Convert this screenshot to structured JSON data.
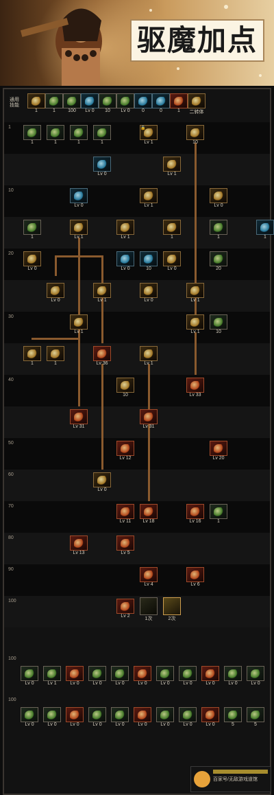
{
  "banner": {
    "title": "驱魔加点"
  },
  "header": {
    "general_skills_label": "通用\n技能",
    "lv_label": "Lv.",
    "items": [
      "1",
      "1",
      "100",
      "Lv 0",
      "10",
      "Lv 0",
      "0",
      "0",
      "1",
      "二转体"
    ]
  },
  "row_labels": [
    "1",
    "10",
    "20",
    "30",
    "40",
    "50",
    "60",
    "70",
    "80",
    "90",
    "100",
    "100",
    "100"
  ],
  "skills": [
    {
      "r": 0,
      "c": 0,
      "t": "1",
      "k": "g"
    },
    {
      "r": 0,
      "c": 1,
      "t": "1",
      "k": "g"
    },
    {
      "r": 0,
      "c": 2,
      "t": "1",
      "k": "g"
    },
    {
      "r": 0,
      "c": 3,
      "t": "1",
      "k": "g"
    },
    {
      "r": 0,
      "c": 5,
      "t": "Lv 1",
      "k": "gold",
      "lock": true
    },
    {
      "r": 0,
      "c": 7,
      "t": "10",
      "k": "gold"
    },
    {
      "r": 1,
      "c": 3,
      "t": "Lv 0",
      "k": "blue"
    },
    {
      "r": 1,
      "c": 6,
      "t": "Lv 1",
      "k": "gold"
    },
    {
      "r": 2,
      "c": 2,
      "t": "Lv 0",
      "k": "blue"
    },
    {
      "r": 2,
      "c": 5,
      "t": "Lv 1",
      "k": "gold"
    },
    {
      "r": 2,
      "c": 8,
      "t": "Lv 0",
      "k": "gold"
    },
    {
      "r": 3,
      "c": 0,
      "t": "1",
      "k": "g"
    },
    {
      "r": 3,
      "c": 2,
      "t": "Lv 1",
      "k": "gold"
    },
    {
      "r": 3,
      "c": 4,
      "t": "Lv 1",
      "k": "gold"
    },
    {
      "r": 3,
      "c": 6,
      "t": "1",
      "k": "gold"
    },
    {
      "r": 3,
      "c": 8,
      "t": "1",
      "k": "g"
    },
    {
      "r": 3,
      "c": 10,
      "t": "1",
      "k": "blue"
    },
    {
      "r": 4,
      "c": 0,
      "t": "Lv 0",
      "k": "gold"
    },
    {
      "r": 4,
      "c": 4,
      "t": "Lv 0",
      "k": "blue"
    },
    {
      "r": 4,
      "c": 5,
      "t": "10",
      "k": "blue"
    },
    {
      "r": 4,
      "c": 6,
      "t": "Lv 0",
      "k": "gold"
    },
    {
      "r": 4,
      "c": 8,
      "t": "20",
      "k": "g"
    },
    {
      "r": 5,
      "c": 1,
      "t": "Lv 0",
      "k": "gold"
    },
    {
      "r": 5,
      "c": 3,
      "t": "Lv 1",
      "k": "gold"
    },
    {
      "r": 5,
      "c": 5,
      "t": "Lv 0",
      "k": "gold"
    },
    {
      "r": 5,
      "c": 7,
      "t": "Lv 1",
      "k": "gold"
    },
    {
      "r": 6,
      "c": 2,
      "t": "Lv 1",
      "k": "gold"
    },
    {
      "r": 6,
      "c": 7,
      "t": "Lv 1",
      "k": "gold"
    },
    {
      "r": 6,
      "c": 8,
      "t": "10",
      "k": "g"
    },
    {
      "r": 7,
      "c": 0,
      "t": "1",
      "k": "gold"
    },
    {
      "r": 7,
      "c": 1,
      "t": "1",
      "k": "gold"
    },
    {
      "r": 7,
      "c": 3,
      "t": "Lv 36",
      "k": "red"
    },
    {
      "r": 7,
      "c": 5,
      "t": "Lv 1",
      "k": "gold"
    },
    {
      "r": 8,
      "c": 4,
      "t": "10",
      "k": "gold"
    },
    {
      "r": 8,
      "c": 7,
      "t": "Lv 33",
      "k": "red"
    },
    {
      "r": 9,
      "c": 2,
      "t": "Lv 31",
      "k": "red"
    },
    {
      "r": 9,
      "c": 5,
      "t": "Lv 31",
      "k": "red"
    },
    {
      "r": 10,
      "c": 4,
      "t": "Lv 12",
      "k": "red"
    },
    {
      "r": 10,
      "c": 8,
      "t": "Lv 20",
      "k": "red"
    },
    {
      "r": 11,
      "c": 3,
      "t": "Lv 0",
      "k": "gold"
    },
    {
      "r": 12,
      "c": 4,
      "t": "Lv 11",
      "k": "red"
    },
    {
      "r": 12,
      "c": 5,
      "t": "Lv 18",
      "k": "red"
    },
    {
      "r": 12,
      "c": 7,
      "t": "Lv 16",
      "k": "red"
    },
    {
      "r": 12,
      "c": 8,
      "t": "1",
      "k": "g"
    },
    {
      "r": 13,
      "c": 2,
      "t": "Lv 13",
      "k": "red"
    },
    {
      "r": 13,
      "c": 4,
      "t": "Lv 5",
      "k": "red"
    },
    {
      "r": 14,
      "c": 5,
      "t": "Lv 4",
      "k": "red"
    },
    {
      "r": 14,
      "c": 7,
      "t": "Lv 6",
      "k": "red"
    },
    {
      "r": 15,
      "c": 4,
      "t": "Lv 2",
      "k": "red"
    }
  ],
  "awaken": [
    {
      "label": "1次"
    },
    {
      "label": "2次"
    }
  ],
  "bottom_row_1": [
    "Lv 0",
    "Lv 1",
    "Lv 0",
    "Lv 0",
    "Lv 0",
    "Lv 0",
    "Lv 0",
    "Lv 0",
    "Lv 0",
    "Lv 0",
    "Lv 0"
  ],
  "bottom_row_2": [
    "Lv 0",
    "Lv 0",
    "Lv 0",
    "Lv 0",
    "Lv 0",
    "Lv 0",
    "Lv 0",
    "Lv 0",
    "Lv 0",
    "5",
    "5"
  ],
  "watermark": {
    "text": "百家号/无敌游戏道馆"
  }
}
